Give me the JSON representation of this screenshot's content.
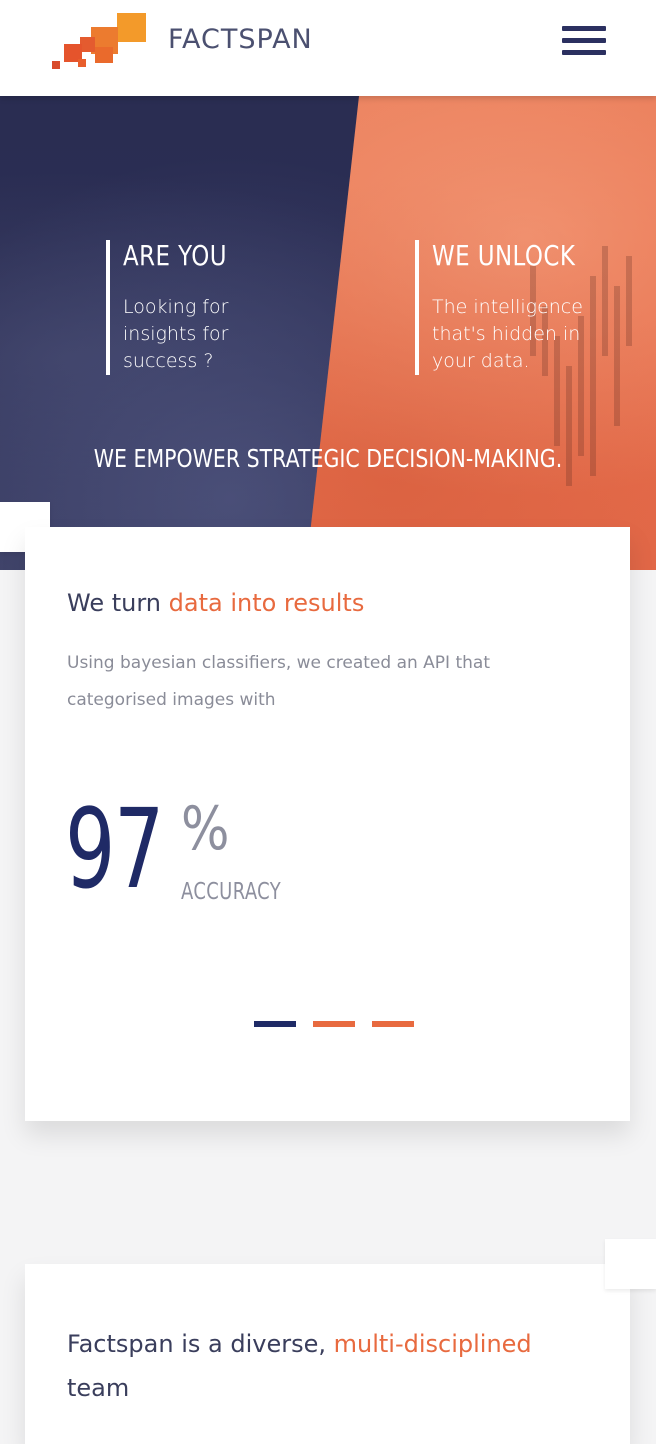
{
  "header": {
    "logo_text": "FACTSPAN",
    "colors": {
      "brand_navy": "#2b3060",
      "brand_orange": "#e86a3f"
    }
  },
  "hero": {
    "left": {
      "title": "ARE YOU",
      "body": "Looking for\ninsights for\nsuccess ?"
    },
    "right": {
      "title": "WE UNLOCK",
      "body": "The intelligence\nthat's hidden in\nyour data."
    },
    "tagline": "WE EMPOWER STRATEGIC DECISION-MAKING."
  },
  "card1": {
    "heading_prefix": "We turn ",
    "heading_accent": "data into results",
    "description": "Using bayesian classifiers, we created an API that categorised images with",
    "stat": {
      "value": "97",
      "unit": "%",
      "label": "ACCURACY"
    },
    "slides": [
      "slide-1",
      "slide-2",
      "slide-3"
    ],
    "active_slide": 1
  },
  "card2": {
    "heading_prefix": "Factspan is a diverse, ",
    "heading_accent": "multi-disciplined",
    "heading_suffix": " team"
  }
}
